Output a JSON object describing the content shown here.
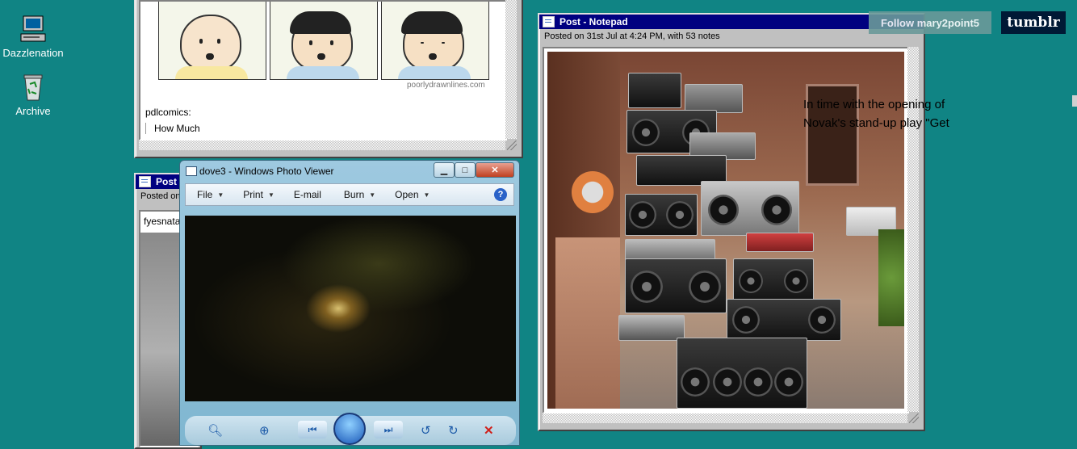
{
  "desktop": {
    "icons": [
      {
        "label": "Dazzlenation",
        "icon": "computer-icon"
      },
      {
        "label": "Archive",
        "icon": "recycle-bin-icon"
      }
    ]
  },
  "window_top_left": {
    "watermark": "poorlydrawnlines.com",
    "source": "pdlcomics:",
    "quote": "How Much"
  },
  "window_bottom_left": {
    "title": "Post -",
    "meta": "Posted on",
    "user": "fyesnata"
  },
  "photo_viewer": {
    "title": "dove3 - Windows Photo Viewer",
    "menu": [
      "File",
      "Print",
      "E-mail",
      "Burn",
      "Open"
    ],
    "help_icon": "help-icon"
  },
  "notepad": {
    "title": "Post - Notepad",
    "meta": "Posted on 31st Jul at 4:24 PM, with 53 notes",
    "overlay_text": "In time with the opening of Novak's stand-up play \"Get"
  },
  "tumblr": {
    "follow_label": "Follow mary2point5",
    "logo": "tumblr"
  },
  "colors": {
    "desktop": "#108484",
    "title_bar": "#000080",
    "tumblr": "#001935"
  }
}
